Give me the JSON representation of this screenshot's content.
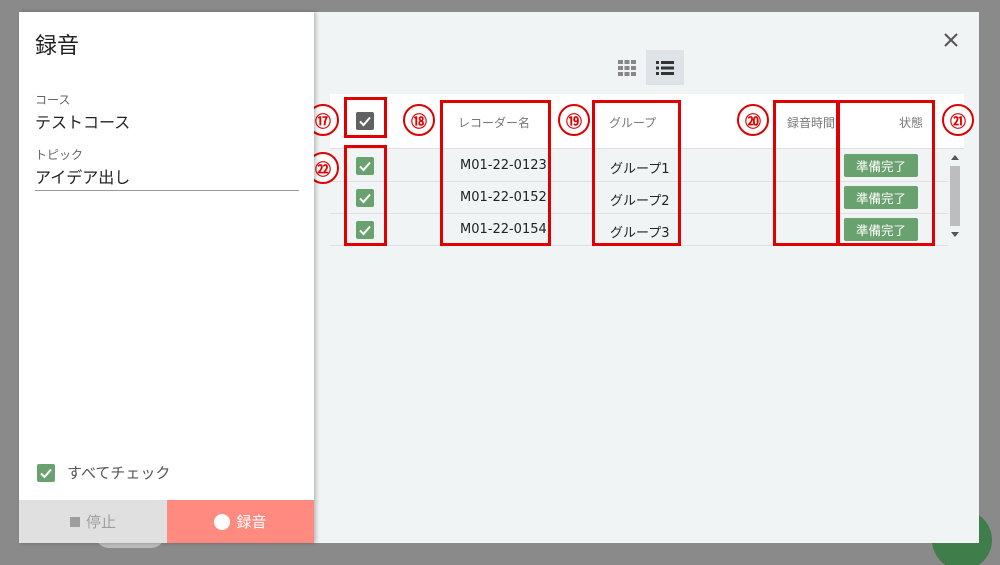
{
  "dialog": {
    "title": "録音",
    "course_label": "コース",
    "course_value": "テストコース",
    "topic_label": "トピック",
    "topic_value": "アイデア出し",
    "check_all_label": "すべてチェック",
    "stop_label": "停止",
    "record_label": "録音"
  },
  "table": {
    "headers": {
      "recorder": "レコーダー名",
      "group": "グループ",
      "time": "録音時間",
      "status": "状態"
    },
    "rows": [
      {
        "recorder": "M01-22-0123",
        "group": "グループ1",
        "time": "",
        "status": "準備完了",
        "checked": true
      },
      {
        "recorder": "M01-22-0152",
        "group": "グループ2",
        "time": "",
        "status": "準備完了",
        "checked": true
      },
      {
        "recorder": "M01-22-0154",
        "group": "グループ3",
        "time": "",
        "status": "準備完了",
        "checked": true
      }
    ]
  },
  "annotations": {
    "m17": "⑰",
    "m18": "⑱",
    "m19": "⑲",
    "m20": "⑳",
    "m21": "㉑",
    "m22": "㉒"
  },
  "colors": {
    "accent_green": "#6aa26f",
    "record_red": "#ff8a80",
    "callout_red": "#e00000"
  },
  "icons": {
    "close": "close-icon",
    "grid_view": "grid-view-icon",
    "list_view": "list-view-icon",
    "check": "check-icon"
  }
}
